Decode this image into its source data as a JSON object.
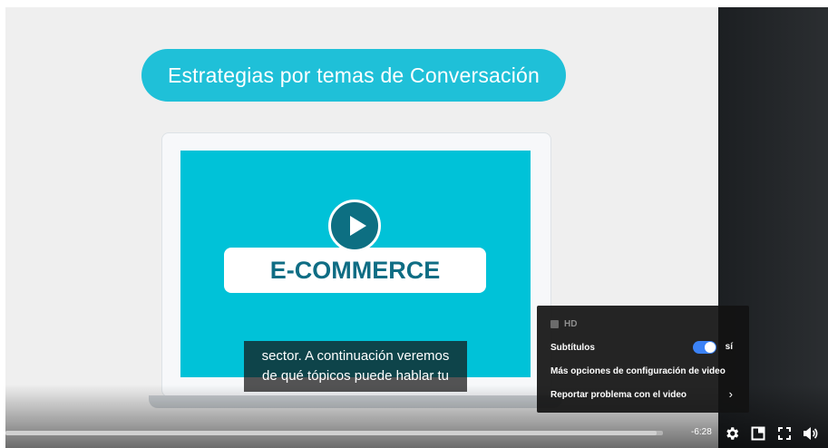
{
  "video": {
    "title_banner": "Estrategias por temas de Conversación",
    "laptop_label": "E-COMMERCE",
    "subtitles": [
      "sector. A continuación veremos",
      "de qué tópicos puede hablar tu"
    ]
  },
  "settings_menu": {
    "hd_label": "HD",
    "subtitles_label": "Subtítulos",
    "subtitles_state": "sí",
    "more_options_label": "Más opciones de configuración de video",
    "report_label": "Reportar problema con el video"
  },
  "controls": {
    "time_remaining": "-6:28",
    "progress_fraction": 0.99,
    "icons": [
      "gear-icon",
      "picture-in-picture-icon",
      "fullscreen-icon",
      "volume-icon"
    ]
  },
  "colors": {
    "accent_teal": "#1fc0d8",
    "screen_teal": "#00c2d8",
    "toggle_blue": "#3b82f6"
  }
}
